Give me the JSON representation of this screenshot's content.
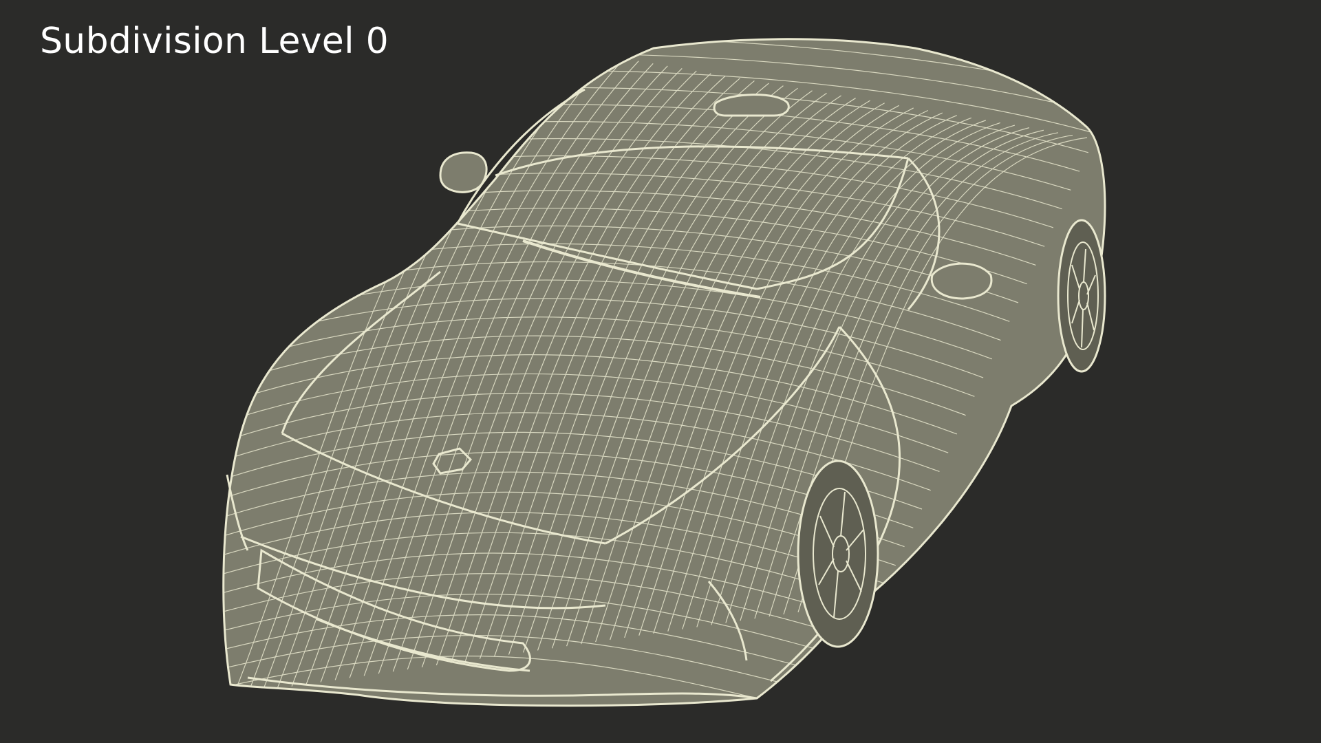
{
  "caption": {
    "text": "Subdivision Level 0"
  },
  "render": {
    "subject": "car-wireframe",
    "background_color": "#2b2b29",
    "mesh_fill_color": "#7d7d6d",
    "mesh_line_color": "#e9e8cf",
    "shadow_fill_color": "#5f5f52"
  }
}
